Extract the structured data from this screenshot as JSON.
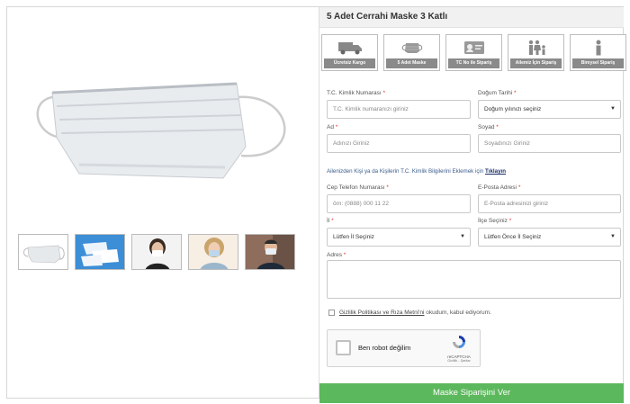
{
  "product": {
    "title": "5 Adet Cerrahi Maske 3 Katlı"
  },
  "features": [
    {
      "label": "Ücretsiz Kargo",
      "icon": "truck-icon"
    },
    {
      "label": "5 Adet Maske",
      "icon": "mask-icon"
    },
    {
      "label": "TC No ile Sipariş",
      "icon": "id-card-icon"
    },
    {
      "label": "Ailemiz İçin Sipariş",
      "icon": "family-icon"
    },
    {
      "label": "Bireysel Sipariş",
      "icon": "person-icon"
    }
  ],
  "form": {
    "tc": {
      "label": "T.C. Kimlik Numarası",
      "placeholder": "T.C. Kimlik numaranızı giriniz"
    },
    "birth": {
      "label": "Doğum Tarihi",
      "value": "Doğum yılınızı seçiniz"
    },
    "name": {
      "label": "Ad",
      "placeholder": "Adınızı Giriniz"
    },
    "surname": {
      "label": "Soyad",
      "placeholder": "Soyadınızı Giriniz"
    },
    "info_text": "Ailenizden Kişi ya da Kişilerin T.C. Kimlik Bilgilerini Eklemek için",
    "info_link": "Tıklayın",
    "phone": {
      "label": "Cep Telefon Numarası",
      "placeholder": "örn: (0888) 000 11 22"
    },
    "email": {
      "label": "E-Posta Adresi",
      "placeholder": "E-Posta adresinizi giriniz"
    },
    "city": {
      "label": "İl",
      "value": "Lütfen İl Seçiniz"
    },
    "district": {
      "label": "İlçe Seçiniz",
      "value": "Lütfen Önce İl Seçiniz"
    },
    "address": {
      "label": "Adres"
    },
    "required_mark": "*",
    "consent_link": "Gizlilik Politikası ve Rıza Metni'ni",
    "consent_text": "okudum, kabul ediyorum.",
    "captcha_text": "Ben robot değilim",
    "captcha_brand": "reCAPTCHA",
    "captcha_terms": "Gizlilik - Şartlar",
    "submit_label": "Maske Siparişini Ver"
  },
  "colors": {
    "submit": "#5cb85c",
    "feature_label_bg": "#8a8a8a",
    "link": "#1a2f6a"
  }
}
